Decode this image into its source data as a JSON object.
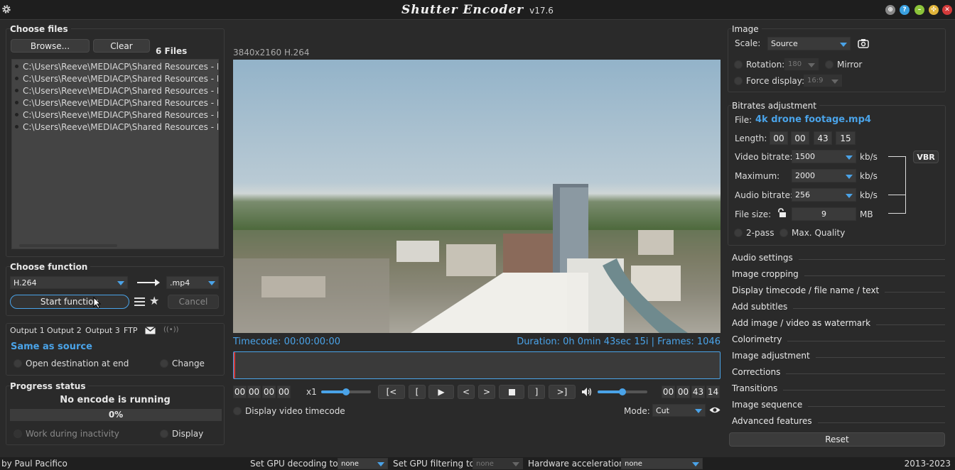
{
  "app": {
    "title": "Shutter Encoder",
    "version": "v17.6"
  },
  "files": {
    "section_title": "Choose files",
    "browse_label": "Browse...",
    "clear_label": "Clear",
    "count_label": "6 Files",
    "items": [
      "C:\\Users\\Reeve\\MEDIACP\\Shared Resources - Do",
      "C:\\Users\\Reeve\\MEDIACP\\Shared Resources - Do",
      "C:\\Users\\Reeve\\MEDIACP\\Shared Resources - Do",
      "C:\\Users\\Reeve\\MEDIACP\\Shared Resources - Do",
      "C:\\Users\\Reeve\\MEDIACP\\Shared Resources - Do",
      "C:\\Users\\Reeve\\MEDIACP\\Shared Resources - Do"
    ]
  },
  "function": {
    "section_title": "Choose function",
    "codec": "H.264",
    "container": ".mp4",
    "start_label": "Start function",
    "cancel_label": "Cancel"
  },
  "output": {
    "tabs": [
      "Output 1",
      "Output 2",
      "Output 3",
      "FTP"
    ],
    "destination": "Same as source",
    "open_dest_label": "Open destination at end",
    "change_label": "Change"
  },
  "progress": {
    "section_title": "Progress status",
    "status": "No encode is running",
    "percent_label": "0%",
    "value": 0,
    "work_inactivity_label": "Work during inactivity",
    "display_label": "Display"
  },
  "player": {
    "resolution_label": "3840x2160 H.264",
    "timecode_label": "Timecode: 00:00:00:00",
    "duration_label": "Duration: 0h 0min 43sec 15i | Frames: 1046",
    "start_tc": [
      "00",
      "00",
      "00",
      "00"
    ],
    "speed_label": "x1",
    "speed_level": 0.5,
    "volume_level": 0.5,
    "end_tc": [
      "00",
      "00",
      "43",
      "14"
    ],
    "display_tc_label": "Display video timecode",
    "mode_label": "Mode:",
    "mode_value": "Cut"
  },
  "image": {
    "section_title": "Image",
    "scale_label": "Scale:",
    "scale_value": "Source",
    "rotation_label": "Rotation:",
    "rotation_value": "180",
    "mirror_label": "Mirror",
    "force_label": "Force display:",
    "force_value": "16:9"
  },
  "bitrates": {
    "section_title": "Bitrates adjustment",
    "file_label": "File:",
    "file_name": "4k drone footage.mp4",
    "length_label": "Length:",
    "length": [
      "00",
      "00",
      "43",
      "15"
    ],
    "video_label": "Video bitrate:",
    "video_value": "1500",
    "max_label": "Maximum:",
    "max_value": "2000",
    "audio_label": "Audio bitrate:",
    "audio_value": "256",
    "unit_kbs": "kb/s",
    "filesize_label": "File size:",
    "filesize_value": "9",
    "unit_mb": "MB",
    "vbr_label": "VBR",
    "twopass_label": "2-pass",
    "maxq_label": "Max. Quality"
  },
  "settings_sections": [
    "Audio settings",
    "Image cropping",
    "Display timecode / file name / text",
    "Add subtitles",
    "Add image / video as watermark",
    "Colorimetry",
    "Image adjustment",
    "Corrections",
    "Transitions",
    "Image sequence",
    "Advanced features"
  ],
  "reset_label": "Reset",
  "status": {
    "author": "by Paul Pacifico",
    "gpu_decoding_label": "Set GPU decoding to:",
    "gpu_decoding_value": "none",
    "gpu_filtering_label": "Set GPU filtering to:",
    "gpu_filtering_value": "none",
    "hw_label": "Hardware acceleration:",
    "hw_value": "none",
    "years": "2013-2023"
  },
  "colors": {
    "accent": "#4aa3e8",
    "background": "#2a2a2a",
    "panel": "#3a3a3a"
  },
  "icons": [
    "gear-icon",
    "globe-icon",
    "help-icon",
    "minimize-icon",
    "maximize-icon",
    "close-icon",
    "arrow-right-icon",
    "menu-icon",
    "star-icon",
    "mail-icon",
    "stream-icon",
    "camera-icon",
    "lock-icon",
    "volume-icon",
    "eye-icon"
  ]
}
